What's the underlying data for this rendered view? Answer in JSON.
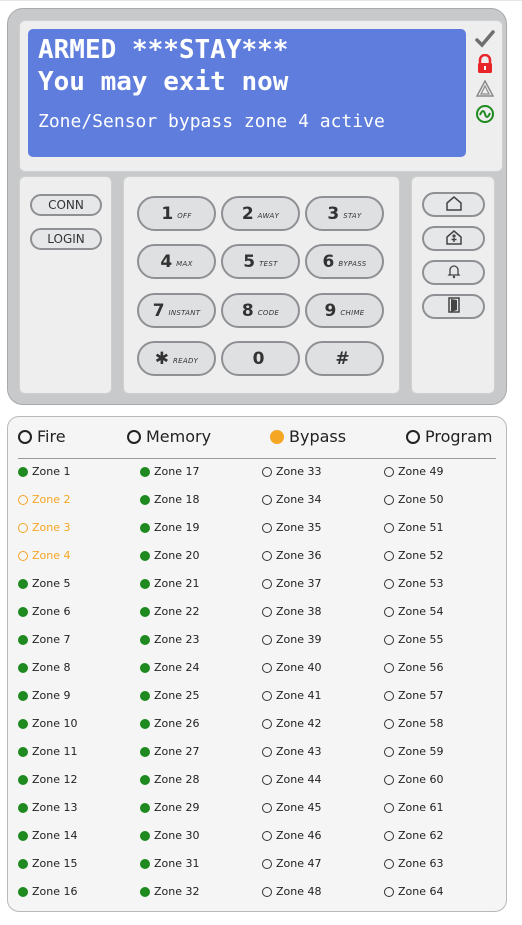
{
  "lcd": {
    "line1": "ARMED ***STAY***",
    "line2": "You may exit now",
    "line3": "Zone/Sensor bypass zone 4 active"
  },
  "status_icons": [
    "check-icon",
    "lock-icon",
    "warning-icon",
    "ac-power-icon"
  ],
  "left_buttons": [
    "CONN",
    "LOGIN"
  ],
  "keys": [
    {
      "label": "1",
      "sub": "OFF"
    },
    {
      "label": "2",
      "sub": "AWAY"
    },
    {
      "label": "3",
      "sub": "STAY"
    },
    {
      "label": "4",
      "sub": "MAX"
    },
    {
      "label": "5",
      "sub": "TEST"
    },
    {
      "label": "6",
      "sub": "BYPASS"
    },
    {
      "label": "7",
      "sub": "INSTANT"
    },
    {
      "label": "8",
      "sub": "CODE"
    },
    {
      "label": "9",
      "sub": "CHIME"
    },
    {
      "label": "✱",
      "sub": "READY"
    },
    {
      "label": "0",
      "sub": ""
    },
    {
      "label": "#",
      "sub": ""
    }
  ],
  "right_buttons": [
    "home-icon",
    "person-house-icon",
    "bell-icon",
    "exit-door-icon"
  ],
  "legend": [
    {
      "label": "Fire",
      "state": "off"
    },
    {
      "label": "Memory",
      "state": "off"
    },
    {
      "label": "Bypass",
      "state": "on"
    },
    {
      "label": "Program",
      "state": "off"
    }
  ],
  "colors": {
    "ready": "#1f8a1f",
    "bypass": "#f5a623",
    "lcd": "#5f7ddc"
  },
  "zones": [
    {
      "label": "Zone 1",
      "state": "ready"
    },
    {
      "label": "Zone 2",
      "state": "bypassed"
    },
    {
      "label": "Zone 3",
      "state": "bypassed"
    },
    {
      "label": "Zone 4",
      "state": "bypassed"
    },
    {
      "label": "Zone 5",
      "state": "ready"
    },
    {
      "label": "Zone 6",
      "state": "ready"
    },
    {
      "label": "Zone 7",
      "state": "ready"
    },
    {
      "label": "Zone 8",
      "state": "ready"
    },
    {
      "label": "Zone 9",
      "state": "ready"
    },
    {
      "label": "Zone 10",
      "state": "ready"
    },
    {
      "label": "Zone 11",
      "state": "ready"
    },
    {
      "label": "Zone 12",
      "state": "ready"
    },
    {
      "label": "Zone 13",
      "state": "ready"
    },
    {
      "label": "Zone 14",
      "state": "ready"
    },
    {
      "label": "Zone 15",
      "state": "ready"
    },
    {
      "label": "Zone 16",
      "state": "ready"
    },
    {
      "label": "Zone 17",
      "state": "ready"
    },
    {
      "label": "Zone 18",
      "state": "ready"
    },
    {
      "label": "Zone 19",
      "state": "ready"
    },
    {
      "label": "Zone 20",
      "state": "ready"
    },
    {
      "label": "Zone 21",
      "state": "ready"
    },
    {
      "label": "Zone 22",
      "state": "ready"
    },
    {
      "label": "Zone 23",
      "state": "ready"
    },
    {
      "label": "Zone 24",
      "state": "ready"
    },
    {
      "label": "Zone 25",
      "state": "ready"
    },
    {
      "label": "Zone 26",
      "state": "ready"
    },
    {
      "label": "Zone 27",
      "state": "ready"
    },
    {
      "label": "Zone 28",
      "state": "ready"
    },
    {
      "label": "Zone 29",
      "state": "ready"
    },
    {
      "label": "Zone 30",
      "state": "ready"
    },
    {
      "label": "Zone 31",
      "state": "ready"
    },
    {
      "label": "Zone 32",
      "state": "ready"
    },
    {
      "label": "Zone 33",
      "state": "inactive"
    },
    {
      "label": "Zone 34",
      "state": "inactive"
    },
    {
      "label": "Zone 35",
      "state": "inactive"
    },
    {
      "label": "Zone 36",
      "state": "inactive"
    },
    {
      "label": "Zone 37",
      "state": "inactive"
    },
    {
      "label": "Zone 38",
      "state": "inactive"
    },
    {
      "label": "Zone 39",
      "state": "inactive"
    },
    {
      "label": "Zone 40",
      "state": "inactive"
    },
    {
      "label": "Zone 41",
      "state": "inactive"
    },
    {
      "label": "Zone 42",
      "state": "inactive"
    },
    {
      "label": "Zone 43",
      "state": "inactive"
    },
    {
      "label": "Zone 44",
      "state": "inactive"
    },
    {
      "label": "Zone 45",
      "state": "inactive"
    },
    {
      "label": "Zone 46",
      "state": "inactive"
    },
    {
      "label": "Zone 47",
      "state": "inactive"
    },
    {
      "label": "Zone 48",
      "state": "inactive"
    },
    {
      "label": "Zone 49",
      "state": "inactive"
    },
    {
      "label": "Zone 50",
      "state": "inactive"
    },
    {
      "label": "Zone 51",
      "state": "inactive"
    },
    {
      "label": "Zone 52",
      "state": "inactive"
    },
    {
      "label": "Zone 53",
      "state": "inactive"
    },
    {
      "label": "Zone 54",
      "state": "inactive"
    },
    {
      "label": "Zone 55",
      "state": "inactive"
    },
    {
      "label": "Zone 56",
      "state": "inactive"
    },
    {
      "label": "Zone 57",
      "state": "inactive"
    },
    {
      "label": "Zone 58",
      "state": "inactive"
    },
    {
      "label": "Zone 59",
      "state": "inactive"
    },
    {
      "label": "Zone 60",
      "state": "inactive"
    },
    {
      "label": "Zone 61",
      "state": "inactive"
    },
    {
      "label": "Zone 62",
      "state": "inactive"
    },
    {
      "label": "Zone 63",
      "state": "inactive"
    },
    {
      "label": "Zone 64",
      "state": "inactive"
    }
  ]
}
